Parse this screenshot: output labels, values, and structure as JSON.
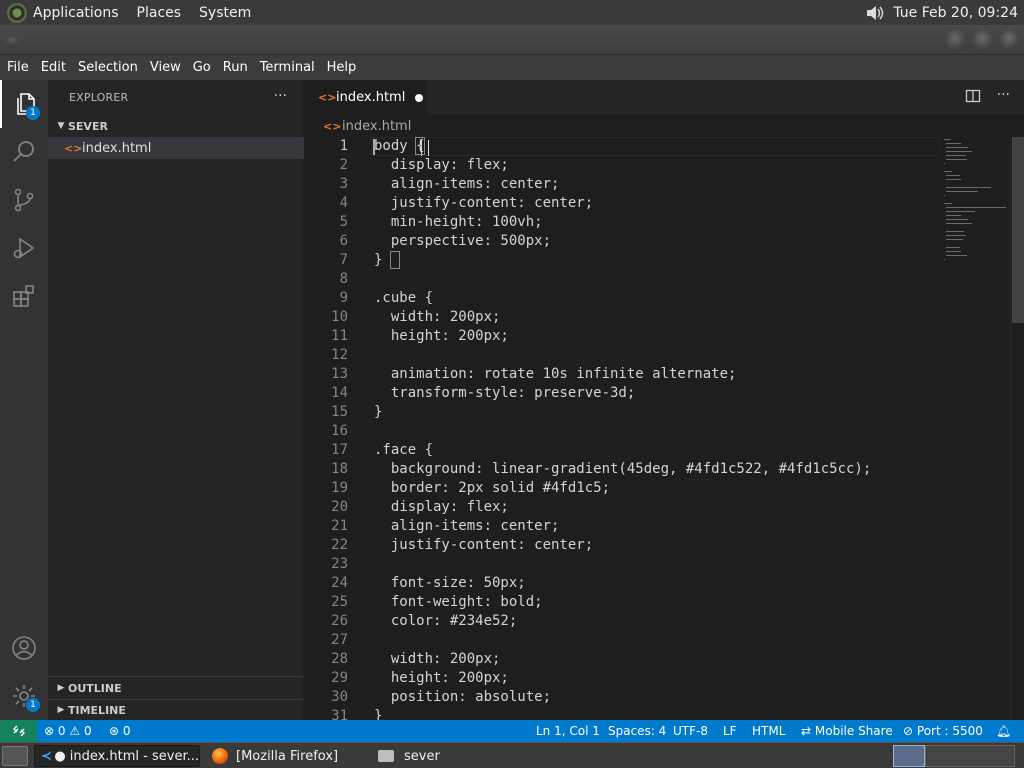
{
  "system_panel": {
    "menus": [
      "Applications",
      "Places",
      "System"
    ],
    "clock": "Tue Feb 20, 09:24",
    "volume_icon": "speaker-icon"
  },
  "menubar": [
    "File",
    "Edit",
    "Selection",
    "View",
    "Go",
    "Run",
    "Terminal",
    "Help"
  ],
  "activity_bar": {
    "items": [
      {
        "icon": "files-icon",
        "badge": "1"
      },
      {
        "icon": "search-icon"
      },
      {
        "icon": "source-control-icon"
      },
      {
        "icon": "run-debug-icon"
      },
      {
        "icon": "extensions-icon"
      }
    ],
    "bottom": [
      {
        "icon": "account-icon"
      },
      {
        "icon": "gear-icon",
        "badge": "1"
      }
    ]
  },
  "sidebar": {
    "title": "EXPLORER",
    "more": "···",
    "folder": "SEVER",
    "files": [
      "index.html"
    ],
    "outline": "OUTLINE",
    "timeline": "TIMELINE"
  },
  "editor": {
    "tab_label": "index.html",
    "breadcrumb": "index.html",
    "lines": [
      "body {",
      "  display: flex;",
      "  align-items: center;",
      "  justify-content: center;",
      "  min-height: 100vh;",
      "  perspective: 500px;",
      "}",
      "",
      ".cube {",
      "  width: 200px;",
      "  height: 200px;",
      "",
      "  animation: rotate 10s infinite alternate;",
      "  transform-style: preserve-3d;",
      "}",
      "",
      ".face {",
      "  background: linear-gradient(45deg, #4fd1c522, #4fd1c5cc);",
      "  border: 2px solid #4fd1c5;",
      "  display: flex;",
      "  align-items: center;",
      "  justify-content: center;",
      "",
      "  font-size: 50px;",
      "  font-weight: bold;",
      "  color: #234e52;",
      "",
      "  width: 200px;",
      "  height: 200px;",
      "  position: absolute;",
      "}"
    ]
  },
  "statusbar": {
    "errors": "0",
    "warnings": "0",
    "ports": "0",
    "position": "Ln 1, Col 1",
    "spaces": "Spaces: 4",
    "encoding": "UTF-8",
    "eol": "LF",
    "language": "HTML",
    "live_share": "Mobile Share",
    "port": "Port : 5500"
  },
  "taskbar": {
    "windows": [
      "index.html - sever...",
      "[Mozilla Firefox]",
      "sever"
    ]
  },
  "colors": {
    "accent": "#007acc",
    "remote": "#16825d",
    "html_icon": "#e37933"
  }
}
